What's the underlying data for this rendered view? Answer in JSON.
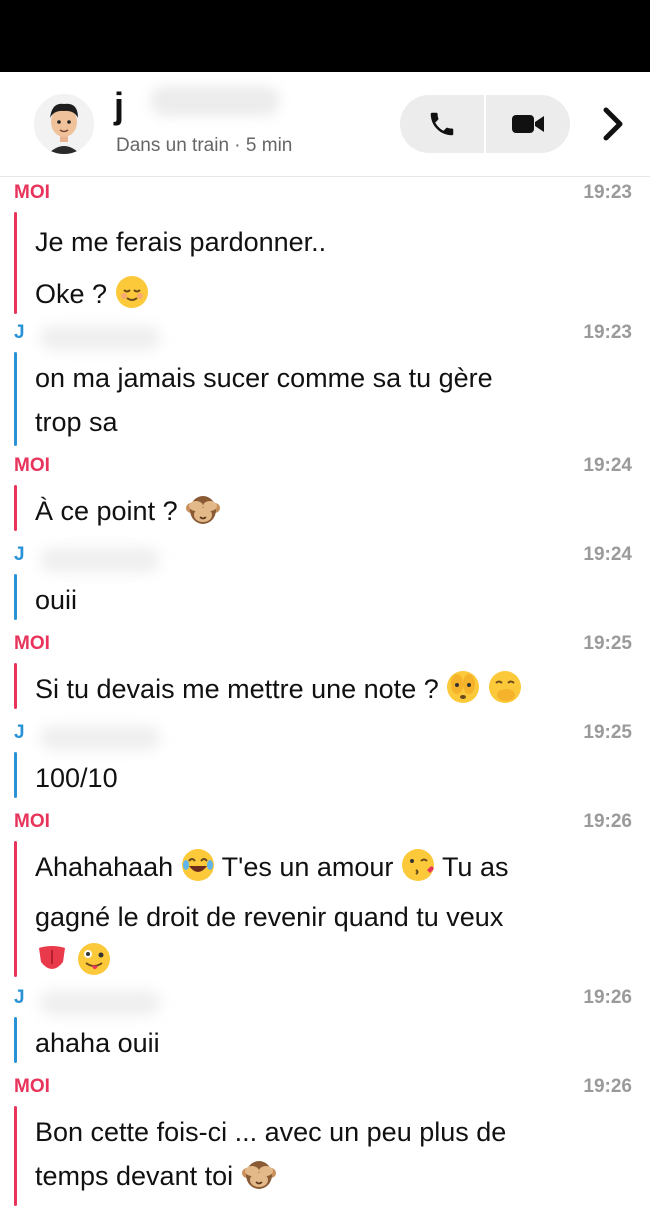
{
  "header": {
    "name_initial": "j",
    "subtitle": "Dans un train · 5 min"
  },
  "messages": [
    {
      "sender": "MOI",
      "time": "19:23",
      "lines": [
        "Je me ferais pardonner..",
        "Oke ?"
      ]
    },
    {
      "sender": "J",
      "time": "19:23",
      "lines": [
        "on ma jamais sucer comme sa tu gère",
        "trop sa"
      ]
    },
    {
      "sender": "MOI",
      "time": "19:24",
      "lines": [
        "À ce point ?"
      ]
    },
    {
      "sender": "J",
      "time": "19:24",
      "lines": [
        "ouii"
      ]
    },
    {
      "sender": "MOI",
      "time": "19:25",
      "lines": [
        "Si tu devais me mettre une note ?"
      ]
    },
    {
      "sender": "J",
      "time": "19:25",
      "lines": [
        "100/10"
      ]
    },
    {
      "sender": "MOI",
      "time": "19:26",
      "lines": [
        "Ahahahaah",
        "T'es un amour",
        "Tu as",
        "gagné le droit de revenir quand tu veux"
      ]
    },
    {
      "sender": "J",
      "time": "19:26",
      "lines": [
        "ahaha ouii"
      ]
    },
    {
      "sender": "MOI",
      "time": "19:26",
      "lines": [
        "Bon cette fois-ci ... avec un peu plus de",
        "temps devant toi"
      ]
    }
  ]
}
